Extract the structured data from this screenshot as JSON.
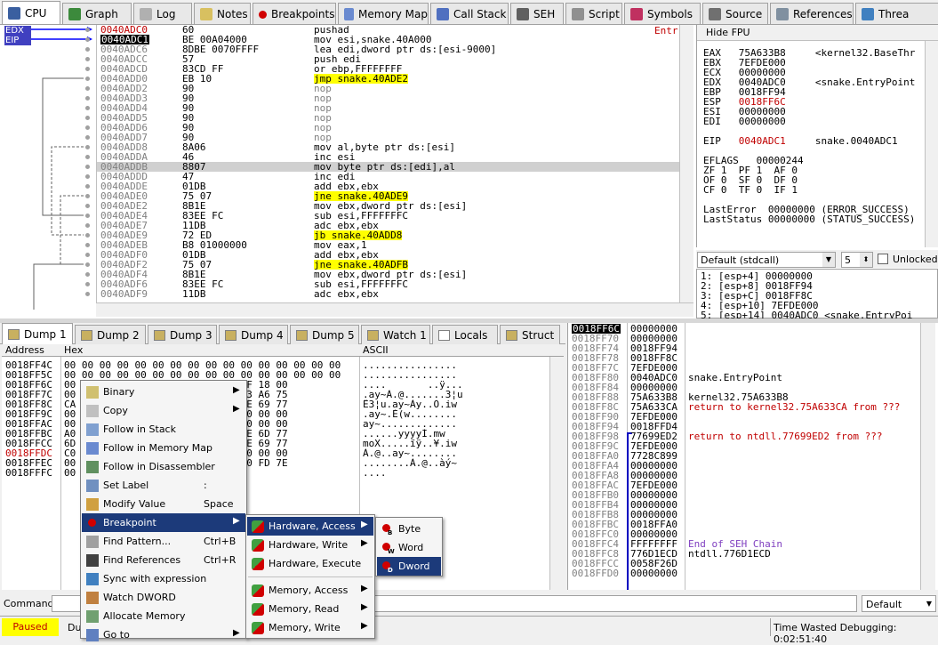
{
  "tabs": [
    {
      "label": "CPU",
      "icon": "cpu-icon"
    },
    {
      "label": "Graph",
      "icon": "graph-icon"
    },
    {
      "label": "Log",
      "icon": "log-icon"
    },
    {
      "label": "Notes",
      "icon": "notes-icon"
    },
    {
      "label": "Breakpoints",
      "icon": "breakpoint-icon"
    },
    {
      "label": "Memory Map",
      "icon": "memory-map-icon"
    },
    {
      "label": "Call Stack",
      "icon": "call-stack-icon"
    },
    {
      "label": "SEH",
      "icon": "seh-icon"
    },
    {
      "label": "Script",
      "icon": "script-icon"
    },
    {
      "label": "Symbols",
      "icon": "symbols-icon"
    },
    {
      "label": "Source",
      "icon": "source-icon"
    },
    {
      "label": "References",
      "icon": "references-icon"
    },
    {
      "label": "Threa",
      "icon": "threads-icon"
    }
  ],
  "reg_tags": [
    "EDX",
    "EIP"
  ],
  "disasm": [
    {
      "addr": "0040ADC0",
      "bytes": "60",
      "ins": "pushad",
      "addr_style": "red"
    },
    {
      "addr": "0040ADC1",
      "bytes": "BE 00A04000",
      "ins": "mov esi,snake.40A000",
      "addr_style": "cur"
    },
    {
      "addr": "0040ADC6",
      "bytes": "8DBE 0070FFFF",
      "ins": "lea edi,dword ptr ds:[esi-9000]"
    },
    {
      "addr": "0040ADCC",
      "bytes": "57",
      "ins": "push edi"
    },
    {
      "addr": "0040ADCD",
      "bytes": "83CD FF",
      "ins": "or ebp,FFFFFFFF"
    },
    {
      "addr": "0040ADD0",
      "bytes": "EB 10",
      "ins": "jmp snake.40ADE2",
      "hl": true
    },
    {
      "addr": "0040ADD2",
      "bytes": "90",
      "ins": "nop",
      "grey": true
    },
    {
      "addr": "0040ADD3",
      "bytes": "90",
      "ins": "nop",
      "grey": true
    },
    {
      "addr": "0040ADD4",
      "bytes": "90",
      "ins": "nop",
      "grey": true
    },
    {
      "addr": "0040ADD5",
      "bytes": "90",
      "ins": "nop",
      "grey": true
    },
    {
      "addr": "0040ADD6",
      "bytes": "90",
      "ins": "nop",
      "grey": true
    },
    {
      "addr": "0040ADD7",
      "bytes": "90",
      "ins": "nop",
      "grey": true
    },
    {
      "addr": "0040ADD8",
      "bytes": "8A06",
      "ins": "mov al,byte ptr ds:[esi]"
    },
    {
      "addr": "0040ADDA",
      "bytes": "46",
      "ins": "inc esi"
    },
    {
      "addr": "0040ADDB",
      "bytes": "8807",
      "ins": "mov byte ptr ds:[edi],al",
      "row_sel": true
    },
    {
      "addr": "0040ADDD",
      "bytes": "47",
      "ins": "inc edi"
    },
    {
      "addr": "0040ADDE",
      "bytes": "01DB",
      "ins": "add ebx,ebx"
    },
    {
      "addr": "0040ADE0",
      "bytes": "75 07",
      "ins": "jne snake.40ADE9",
      "hl": true
    },
    {
      "addr": "0040ADE2",
      "bytes": "8B1E",
      "ins": "mov ebx,dword ptr ds:[esi]"
    },
    {
      "addr": "0040ADE4",
      "bytes": "83EE FC",
      "ins": "sub esi,FFFFFFFC"
    },
    {
      "addr": "0040ADE7",
      "bytes": "11DB",
      "ins": "adc ebx,ebx"
    },
    {
      "addr": "0040ADE9",
      "bytes": "72 ED",
      "ins": "jb snake.40ADD8",
      "hl": true
    },
    {
      "addr": "0040ADEB",
      "bytes": "B8 01000000",
      "ins": "mov eax,1"
    },
    {
      "addr": "0040ADF0",
      "bytes": "01DB",
      "ins": "add ebx,ebx"
    },
    {
      "addr": "0040ADF2",
      "bytes": "75 07",
      "ins": "jne snake.40ADFB",
      "hl": true
    },
    {
      "addr": "0040ADF4",
      "bytes": "8B1E",
      "ins": "mov ebx,dword ptr ds:[esi]"
    },
    {
      "addr": "0040ADF6",
      "bytes": "83EE FC",
      "ins": "sub esi,FFFFFFFC"
    },
    {
      "addr": "0040ADF9",
      "bytes": "11DB",
      "ins": "adc ebx,ebx"
    }
  ],
  "disasm_right": "Entr",
  "fpu": {
    "hide_label": "Hide FPU",
    "rows": [
      "EAX   75A633B8     <kernel32.BaseThr",
      "EBX   7EFDE000",
      "ECX   00000000",
      "EDX   0040ADC0     <snake.EntryPoint",
      "EBP   0018FF94",
      "ESP   0018FF6C",
      "ESI   00000000",
      "EDI   00000000",
      "",
      "EIP   0040ADC1     snake.0040ADC1",
      "",
      "EFLAGS   00000244",
      "ZF 1  PF 1  AF 0",
      "OF 0  SF 0  DF 0",
      "CF 0  TF 0  IF 1",
      "",
      "LastError  00000000 (ERROR_SUCCESS)",
      "LastStatus 00000000 (STATUS_SUCCESS)"
    ]
  },
  "callconv": {
    "value": "Default (stdcall)",
    "count": "5",
    "unlocked": "Unlocked"
  },
  "args": [
    "1: [esp+4] 00000000",
    "2: [esp+8] 0018FF94",
    "3: [esp+C] 0018FF8C",
    "4: [esp+10] 7EFDE000",
    "5: [esp+14] 0040ADC0 <snake.EntryPoi"
  ],
  "dump_tabs": [
    "Dump 1",
    "Dump 2",
    "Dump 3",
    "Dump 4",
    "Dump 5",
    "Watch 1",
    "Locals",
    "Struct"
  ],
  "dump_head": {
    "address": "Address",
    "hex": "Hex",
    "ascii": "ASCII"
  },
  "dump_rows": [
    {
      "addr": "0018FF4C",
      "hex": "00 00 00 00 00 00 00 00 00 00 00 00 00 00 00 00",
      "ascii": "................"
    },
    {
      "addr": "0018FF5C",
      "hex": "00 00 00 00 00 00 00 00 00 00 00 00 00 00 00 00",
      "ascii": "................"
    },
    {
      "addr": "0018FF6C",
      "hex": "00                   18 00 8C FF 18 00",
      "ascii": "....       ..ÿ..."
    },
    {
      "addr": "0018FF7C",
      "hex": "00                   18 00 B8 33 A6 75",
      "ascii": ".ay~À.@.......3¦u"
    },
    {
      "addr": "0018FF8C",
      "hex": "CA                   18 00 D2 9E 69 77",
      "ascii": "Ê3¦u.ay~Ày..Ò.iw"
    },
    {
      "addr": "0018FF9C",
      "hex": "00                   00 00 00 00 00 00",
      "ascii": ".ay~.È(w........"
    },
    {
      "addr": "0018FFAC",
      "hex": "00                   00 00 00 00 00 00",
      "ascii": "ay~............."
    },
    {
      "addr": "0018FFBC",
      "hex": "A0                   FF FF CD 1E 6D 77",
      "ascii": "......yyyyÍ.mw"
    },
    {
      "addr": "0018FFCC",
      "hex": "6D                   18 00 A5 9E 69 77",
      "ascii": "moX.....ïÿ..¥.iw"
    },
    {
      "addr": "0018FFDC",
      "hex": "C0                   00 00 00 00 00 00",
      "ascii": "À.@..ay~........"
    },
    {
      "addr": "0018FFEC",
      "hex": "00                   40 00 00 E0 FD 7E",
      "ascii": "........À.@..àý~"
    },
    {
      "addr": "0018FFFC",
      "hex": "00",
      "ascii": "...."
    }
  ],
  "stack_rows": [
    {
      "addr": "0018FF6C",
      "val": "00000000",
      "cmt": "",
      "cur": true
    },
    {
      "addr": "0018FF70",
      "val": "00000000",
      "cmt": ""
    },
    {
      "addr": "0018FF74",
      "val": "0018FF94",
      "cmt": ""
    },
    {
      "addr": "0018FF78",
      "val": "0018FF8C",
      "cmt": ""
    },
    {
      "addr": "0018FF7C",
      "val": "7EFDE000",
      "cmt": ""
    },
    {
      "addr": "0018FF80",
      "val": "0040ADC0",
      "cmt": "snake.EntryPoint"
    },
    {
      "addr": "0018FF84",
      "val": "00000000",
      "cmt": ""
    },
    {
      "addr": "0018FF88",
      "val": "75A633B8",
      "cmt": "kernel32.75A633B8"
    },
    {
      "addr": "0018FF8C",
      "val": "75A633CA",
      "cmt": "return to kernel32.75A633CA from ???",
      "red": true
    },
    {
      "addr": "0018FF90",
      "val": "7EFDE000",
      "cmt": ""
    },
    {
      "addr": "0018FF94",
      "val": "0018FFD4",
      "cmt": ""
    },
    {
      "addr": "0018FF98",
      "val": "77699ED2",
      "cmt": "return to ntdll.77699ED2 from ???",
      "red": true
    },
    {
      "addr": "0018FF9C",
      "val": "7EFDE000",
      "cmt": ""
    },
    {
      "addr": "0018FFA0",
      "val": "7728C899",
      "cmt": ""
    },
    {
      "addr": "0018FFA4",
      "val": "00000000",
      "cmt": ""
    },
    {
      "addr": "0018FFA8",
      "val": "00000000",
      "cmt": ""
    },
    {
      "addr": "0018FFAC",
      "val": "7EFDE000",
      "cmt": ""
    },
    {
      "addr": "0018FFB0",
      "val": "00000000",
      "cmt": ""
    },
    {
      "addr": "0018FFB4",
      "val": "00000000",
      "cmt": ""
    },
    {
      "addr": "0018FFB8",
      "val": "00000000",
      "cmt": ""
    },
    {
      "addr": "0018FFBC",
      "val": "0018FFA0",
      "cmt": ""
    },
    {
      "addr": "0018FFC0",
      "val": "00000000",
      "cmt": ""
    },
    {
      "addr": "0018FFC4",
      "val": "FFFFFFFF",
      "cmt": "End of SEH Chain",
      "purple": true
    },
    {
      "addr": "0018FFC8",
      "val": "776D1ECD",
      "cmt": "ntdll.776D1ECD"
    },
    {
      "addr": "0018FFCC",
      "val": "0058F26D",
      "cmt": ""
    },
    {
      "addr": "0018FFD0",
      "val": "00000000",
      "cmt": ""
    }
  ],
  "context_menu": [
    {
      "label": "Binary",
      "icon": "binary-icon",
      "arrow": true
    },
    {
      "label": "Copy",
      "icon": "copy-icon",
      "arrow": true
    },
    {
      "label": "Follow in Stack",
      "icon": "follow-stack-icon"
    },
    {
      "label": "Follow in Memory Map",
      "icon": "follow-memory-map-icon"
    },
    {
      "label": "Follow in Disassembler",
      "icon": "follow-disassembler-icon"
    },
    {
      "label": "Set Label",
      "icon": "label-icon",
      "shortcut": ":"
    },
    {
      "label": "Modify Value",
      "icon": "modify-value-icon",
      "shortcut": "Space"
    },
    {
      "label": "Breakpoint",
      "icon": "breakpoint-icon",
      "arrow": true,
      "selected": true
    },
    {
      "label": "Find Pattern...",
      "icon": "find-pattern-icon",
      "shortcut": "Ctrl+B"
    },
    {
      "label": "Find References",
      "icon": "find-references-icon",
      "shortcut": "Ctrl+R"
    },
    {
      "label": "Sync with expression",
      "icon": "sync-icon"
    },
    {
      "label": "Watch DWORD",
      "icon": "watch-icon"
    },
    {
      "label": "Allocate Memory",
      "icon": "allocate-memory-icon"
    },
    {
      "label": "Go to",
      "icon": "goto-icon",
      "arrow": true
    }
  ],
  "bp_menu": [
    {
      "label": "Hardware, Access",
      "arrow": true,
      "selected": true
    },
    {
      "label": "Hardware, Write",
      "arrow": true
    },
    {
      "label": "Hardware, Execute"
    },
    {
      "label": "",
      "separator": true
    },
    {
      "label": "Memory, Access",
      "arrow": true
    },
    {
      "label": "Memory, Read",
      "arrow": true
    },
    {
      "label": "Memory, Write",
      "arrow": true
    }
  ],
  "size_menu": [
    {
      "label": "Byte",
      "badge": "B"
    },
    {
      "label": "Word",
      "badge": "W"
    },
    {
      "label": "Dword",
      "badge": "D",
      "selected": true
    }
  ],
  "command": {
    "label": "Command:",
    "value": "",
    "mode": "Default"
  },
  "status": {
    "state": "Paused",
    "partial": "Du",
    "wasted": "Time Wasted Debugging: 0:02:51:40"
  },
  "colors": {
    "accent": "#1c3a7a",
    "paused": "#ffff00",
    "red": "#c00000",
    "highlight": "#ffff00"
  }
}
